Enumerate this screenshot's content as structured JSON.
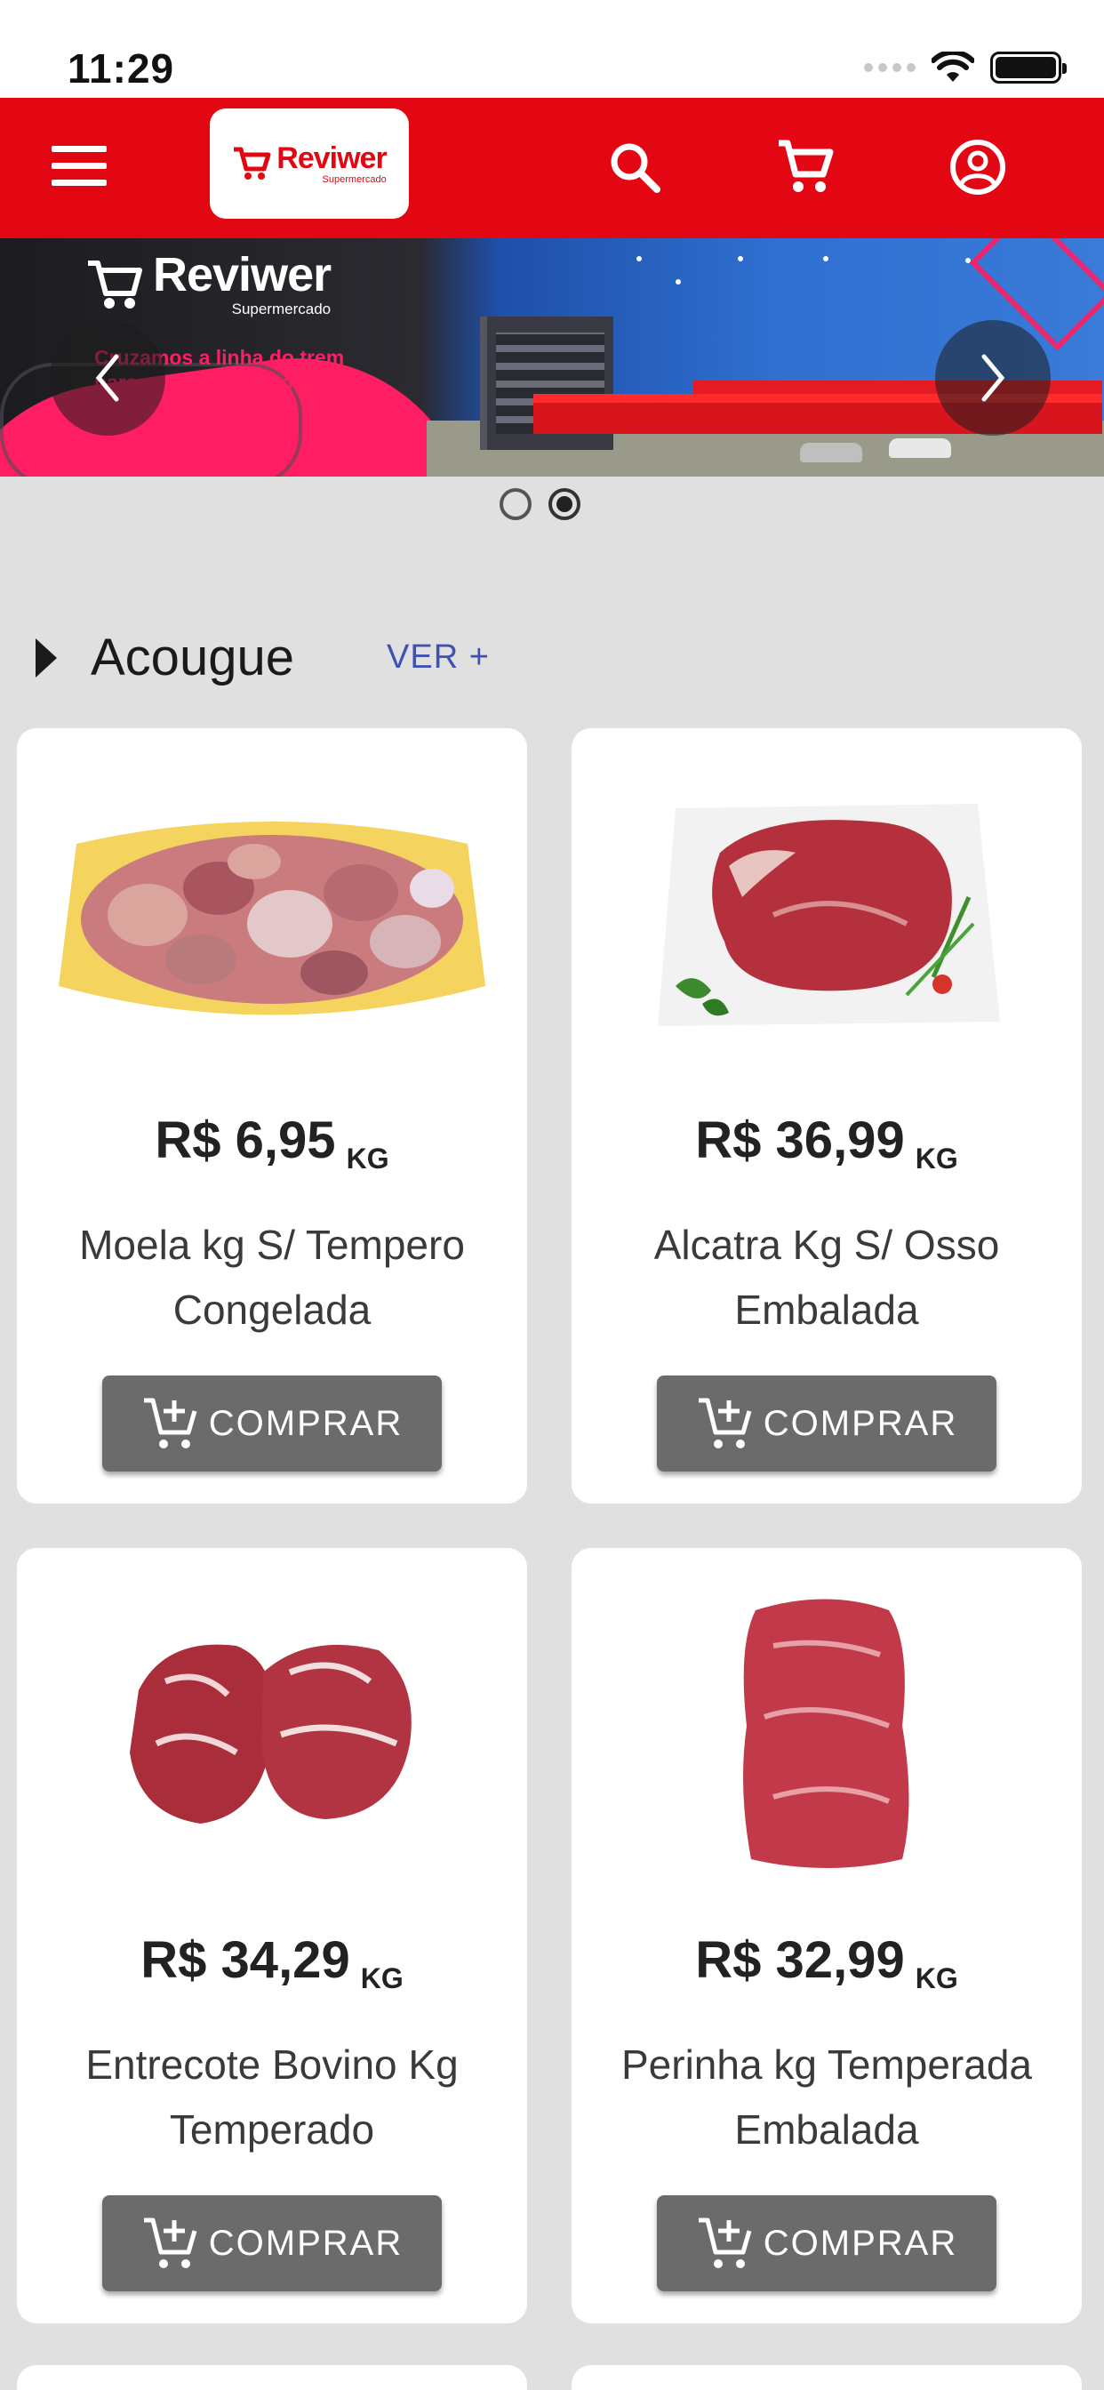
{
  "status_bar": {
    "time": "11:29"
  },
  "header": {
    "logo_name": "Reviwer",
    "logo_sub": "Supermercado"
  },
  "banner": {
    "brand_name": "Reviwer",
    "brand_sub": "Supermercado",
    "tagline": "Cruzamos a linha do trem para novos caminhos",
    "slide_count": 2,
    "active_slide": 2
  },
  "section": {
    "title": "Acougue",
    "see_more": "VER +"
  },
  "products": [
    {
      "price": "R$ 6,95",
      "unit": "KG",
      "name": "Moela kg S/ Tempero Congelada",
      "button": "COMPRAR"
    },
    {
      "price": "R$ 36,99",
      "unit": "KG",
      "name": "Alcatra Kg S/ Osso Embalada",
      "button": "COMPRAR"
    },
    {
      "price": "R$ 34,29",
      "unit": "KG",
      "name": "Entrecote Bovino Kg Temperado",
      "button": "COMPRAR"
    },
    {
      "price": "R$ 32,99",
      "unit": "KG",
      "name": "Perinha kg Temperada Embalada",
      "button": "COMPRAR"
    }
  ],
  "colors": {
    "brand_red": "#e30613",
    "banner_pink": "#ff1e63",
    "link_blue": "#3f51b5",
    "button_gray": "#6b6b6b"
  },
  "icons": [
    "menu-icon",
    "search-icon",
    "cart-icon",
    "account-icon",
    "chevron-left-icon",
    "chevron-right-icon",
    "add-to-cart-icon"
  ]
}
